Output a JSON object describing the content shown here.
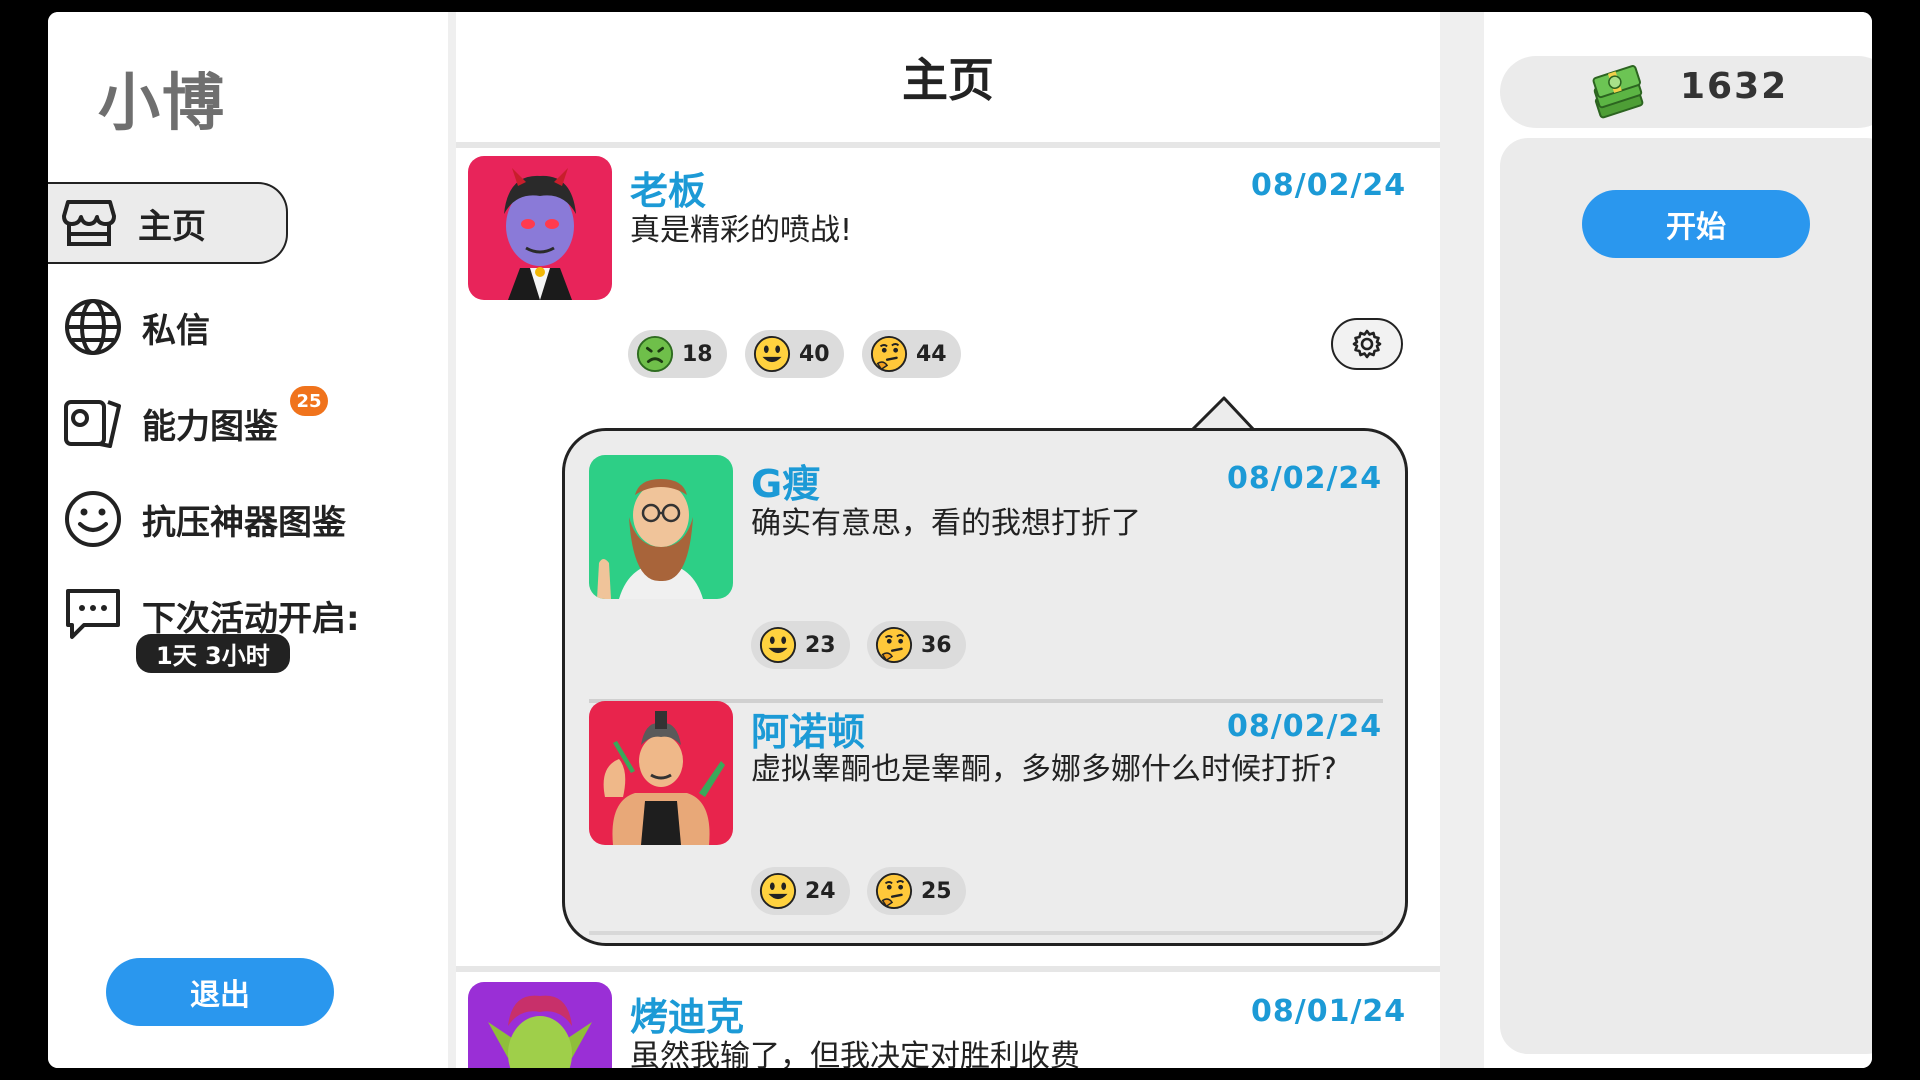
{
  "app": {
    "title": "小博"
  },
  "sidebar": {
    "items": [
      {
        "label": "主页",
        "icon": "shop-icon",
        "active": true
      },
      {
        "label": "私信",
        "icon": "globe-icon"
      },
      {
        "label": "能力图鉴",
        "icon": "cards-icon",
        "badge": "25"
      },
      {
        "label": "抗压神器图鉴",
        "icon": "smiley-icon"
      },
      {
        "label": "下次活动开启:",
        "icon": "chat-icon",
        "countdown": "1天 3小时"
      }
    ],
    "logout_label": "退出"
  },
  "feed": {
    "title": "主页",
    "posts": [
      {
        "name": "老板",
        "date": "08/02/24",
        "text": "真是精彩的喷战!",
        "avatar": "vampire-avatar",
        "reactions": [
          {
            "icon": "sick-emoji",
            "count": "18"
          },
          {
            "icon": "smile-emoji",
            "count": "40"
          },
          {
            "icon": "thinking-emoji",
            "count": "44"
          }
        ],
        "replies": [
          {
            "name": "G瘦",
            "date": "08/02/24",
            "text": "确实有意思，看的我想打折了",
            "avatar": "bearded-man-avatar",
            "reactions": [
              {
                "icon": "smile-emoji",
                "count": "23"
              },
              {
                "icon": "thinking-emoji",
                "count": "36"
              }
            ]
          },
          {
            "name": "阿诺顿",
            "date": "08/02/24",
            "text": "虚拟睾酮也是睾酮，多娜多娜什么时候打折?",
            "avatar": "bodybuilder-avatar",
            "reactions": [
              {
                "icon": "smile-emoji",
                "count": "24"
              },
              {
                "icon": "thinking-emoji",
                "count": "25"
              }
            ]
          }
        ]
      },
      {
        "name": "烤迪克",
        "date": "08/01/24",
        "text": "虽然我输了，但我决定对胜利收费",
        "avatar": "goblin-avatar"
      }
    ]
  },
  "wallet": {
    "amount": "1632",
    "icon": "money-stack-icon"
  },
  "right_panel": {
    "start_label": "开始"
  },
  "colors": {
    "accent": "#2a97ee",
    "name_blue": "#1c9ad6",
    "badge_orange": "#f0731c"
  }
}
